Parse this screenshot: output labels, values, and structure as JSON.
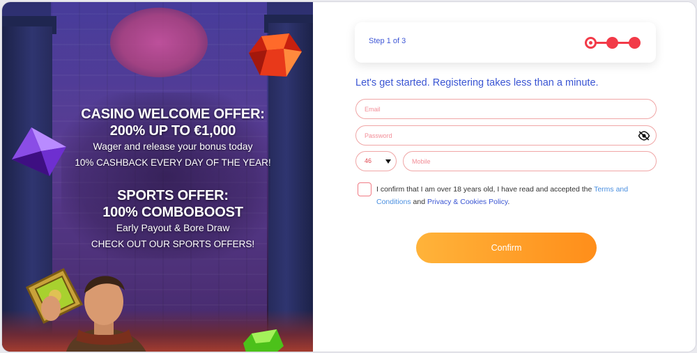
{
  "colors": {
    "accent_red": "#f23a48",
    "accent_blue": "#3a55d3",
    "confirm_orange": "#ff9a20"
  },
  "promo": {
    "casino": {
      "title_line1": "CASINO WELCOME OFFER:",
      "title_line2": "200% UP TO €1,000",
      "subtitle": "Wager and release your bonus today",
      "cashback": "10% CASHBACK EVERY DAY OF THE YEAR!"
    },
    "sports": {
      "title_line1": "SPORTS OFFER:",
      "title_line2": "100% COMBOBOOST",
      "subtitle": "Early Payout & Bore Draw",
      "cta": "CHECK OUT OUR SPORTS OFFERS!"
    }
  },
  "stepper": {
    "label": "Step 1 of 3",
    "current_step": 1,
    "total_steps": 3
  },
  "form": {
    "intro": "Let's get started. Registering takes less than a minute.",
    "email_placeholder": "Email",
    "password_placeholder": "Password",
    "password_toggle_icon": "eye-slash-icon",
    "country_code": "46",
    "mobile_placeholder": "Mobile",
    "consent": {
      "text_before": "I confirm that I am over 18 years old, I have read and accepted the ",
      "terms_link": "Terms and Conditions",
      "text_middle": " and ",
      "privacy_link": "Privacy & Cookies Policy",
      "text_after": "."
    },
    "confirm_label": "Confirm"
  }
}
